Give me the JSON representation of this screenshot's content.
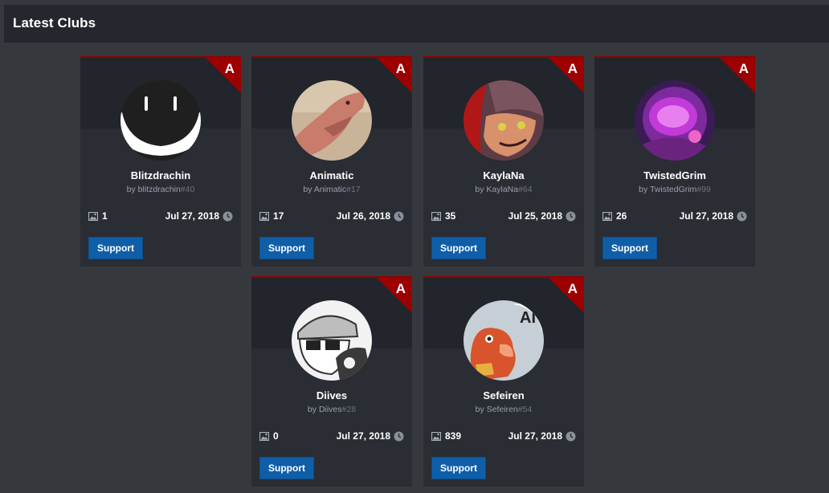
{
  "header": {
    "title": "Latest Clubs"
  },
  "support_label": "Support",
  "rating": "A",
  "by_prefix": "by",
  "clubs": [
    {
      "name": "Blitzdrachin",
      "owner": "blitzdrachin",
      "tag": "#40",
      "images": "1",
      "date": "Jul 27, 2018"
    },
    {
      "name": "Animatic",
      "owner": "Animatic",
      "tag": "#17",
      "images": "17",
      "date": "Jul 26, 2018"
    },
    {
      "name": "KaylaNa",
      "owner": "KaylaNa",
      "tag": "#64",
      "images": "35",
      "date": "Jul 25, 2018"
    },
    {
      "name": "TwistedGrim",
      "owner": "TwistedGrim",
      "tag": "#99",
      "images": "26",
      "date": "Jul 27, 2018"
    },
    {
      "name": "Diives",
      "owner": "Diives",
      "tag": "#28",
      "images": "0",
      "date": "Jul 27, 2018"
    },
    {
      "name": "Sefeiren",
      "owner": "Sefeiren",
      "tag": "#54",
      "images": "839",
      "date": "Jul 27, 2018"
    }
  ],
  "colors": {
    "page_bg": "#35383d",
    "header_bg": "#24272d",
    "card_bg": "#2a2d33",
    "rating_red": "#9c0000",
    "button_blue": "#0f5ea8"
  },
  "icons": {
    "image_count": "image-icon",
    "date": "clock-icon"
  }
}
